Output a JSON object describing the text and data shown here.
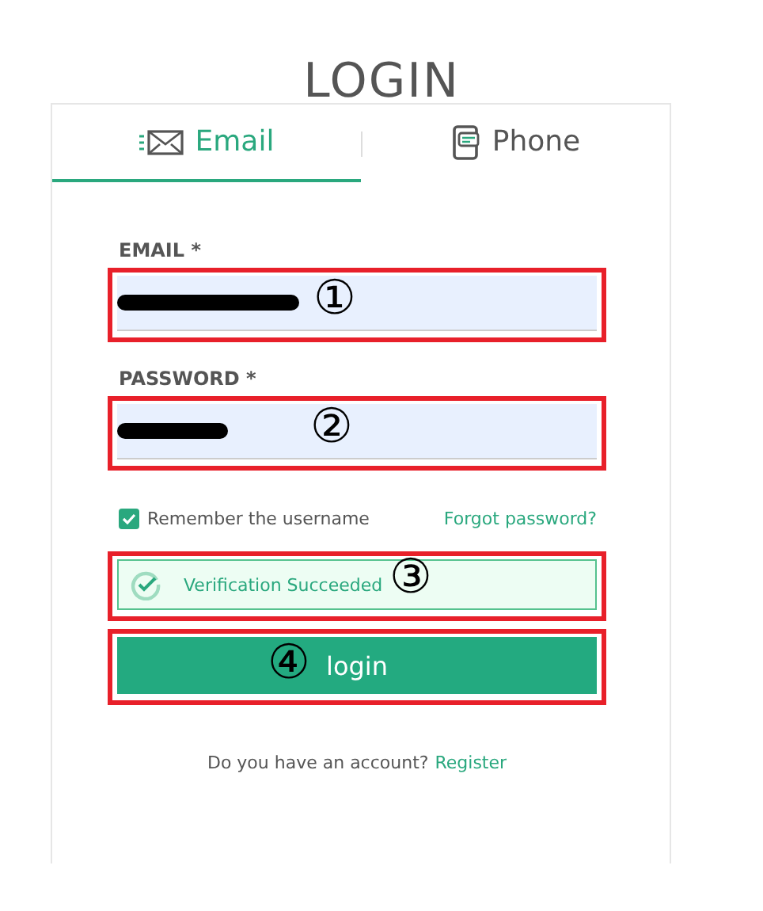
{
  "title": "LOGIN",
  "tabs": [
    {
      "label": "Email",
      "selected": true
    },
    {
      "label": "Phone",
      "selected": false
    }
  ],
  "fields": [
    {
      "label": "EMAIL *",
      "marker": "①"
    },
    {
      "label": "PASSWORD *",
      "marker": "②"
    }
  ],
  "remember": {
    "label": "Remember the username",
    "checked": true
  },
  "forgot": "Forgot password?",
  "verification": {
    "text": "Verification Succeeded",
    "marker": "③",
    "verified": true
  },
  "login": {
    "label": "login",
    "marker": "④"
  },
  "register": {
    "prompt": "Do you have an account?",
    "link": "Register"
  }
}
